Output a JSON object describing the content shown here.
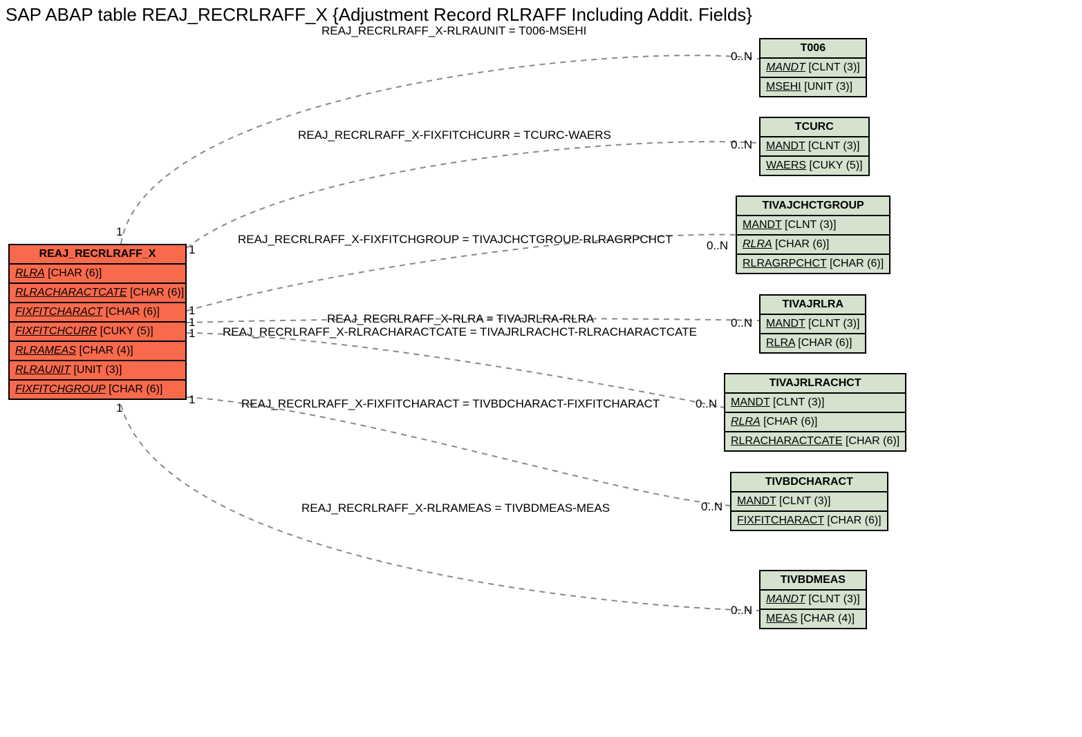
{
  "title": "SAP ABAP table REAJ_RECRLRAFF_X {Adjustment Record RLRAFF Including Addit. Fields}",
  "source": {
    "name": "REAJ_RECRLRAFF_X",
    "fields": [
      {
        "name": "RLRA",
        "type": "[CHAR (6)]",
        "italic": true
      },
      {
        "name": "RLRACHARACTCATE",
        "type": "[CHAR (6)]",
        "italic": true
      },
      {
        "name": "FIXFITCHARACT",
        "type": "[CHAR (6)]",
        "italic": true
      },
      {
        "name": "FIXFITCHCURR",
        "type": "[CUKY (5)]",
        "italic": true
      },
      {
        "name": "RLRAMEAS",
        "type": "[CHAR (4)]",
        "italic": true
      },
      {
        "name": "RLRAUNIT",
        "type": "[UNIT (3)]",
        "italic": true
      },
      {
        "name": "FIXFITCHGROUP",
        "type": "[CHAR (6)]",
        "italic": true
      }
    ]
  },
  "targets": [
    {
      "name": "T006",
      "fields": [
        {
          "name": "MANDT",
          "type": "[CLNT (3)]",
          "italic": true
        },
        {
          "name": "MSEHI",
          "type": "[UNIT (3)]",
          "italic": false
        }
      ]
    },
    {
      "name": "TCURC",
      "fields": [
        {
          "name": "MANDT",
          "type": "[CLNT (3)]",
          "italic": false
        },
        {
          "name": "WAERS",
          "type": "[CUKY (5)]",
          "italic": false
        }
      ]
    },
    {
      "name": "TIVAJCHCTGROUP",
      "fields": [
        {
          "name": "MANDT",
          "type": "[CLNT (3)]",
          "italic": false
        },
        {
          "name": "RLRA",
          "type": "[CHAR (6)]",
          "italic": true
        },
        {
          "name": "RLRAGRPCHCT",
          "type": "[CHAR (6)]",
          "italic": false
        }
      ]
    },
    {
      "name": "TIVAJRLRA",
      "fields": [
        {
          "name": "MANDT",
          "type": "[CLNT (3)]",
          "italic": false
        },
        {
          "name": "RLRA",
          "type": "[CHAR (6)]",
          "italic": false
        }
      ]
    },
    {
      "name": "TIVAJRLRACHCT",
      "fields": [
        {
          "name": "MANDT",
          "type": "[CLNT (3)]",
          "italic": false
        },
        {
          "name": "RLRA",
          "type": "[CHAR (6)]",
          "italic": true
        },
        {
          "name": "RLRACHARACTCATE",
          "type": "[CHAR (6)]",
          "italic": false
        }
      ]
    },
    {
      "name": "TIVBDCHARACT",
      "fields": [
        {
          "name": "MANDT",
          "type": "[CLNT (3)]",
          "italic": false
        },
        {
          "name": "FIXFITCHARACT",
          "type": "[CHAR (6)]",
          "italic": false
        }
      ]
    },
    {
      "name": "TIVBDMEAS",
      "fields": [
        {
          "name": "MANDT",
          "type": "[CLNT (3)]",
          "italic": true
        },
        {
          "name": "MEAS",
          "type": "[CHAR (4)]",
          "italic": false
        }
      ]
    }
  ],
  "relations": [
    {
      "label": "REAJ_RECRLRAFF_X-RLRAUNIT = T006-MSEHI",
      "left_card": "1",
      "right_card": "0..N"
    },
    {
      "label": "REAJ_RECRLRAFF_X-FIXFITCHCURR = TCURC-WAERS",
      "left_card": "1",
      "right_card": "0..N"
    },
    {
      "label": "REAJ_RECRLRAFF_X-FIXFITCHGROUP = TIVAJCHCTGROUP-RLRAGRPCHCT",
      "left_card": "1",
      "right_card": "0..N"
    },
    {
      "label": "REAJ_RECRLRAFF_X-RLRA = TIVAJRLRA-RLRA",
      "left_card": "1",
      "right_card": "0..N"
    },
    {
      "label": "REAJ_RECRLRAFF_X-RLRACHARACTCATE = TIVAJRLRACHCT-RLRACHARACTCATE",
      "left_card": "1",
      "right_card": "0..N"
    },
    {
      "label": "REAJ_RECRLRAFF_X-FIXFITCHARACT = TIVBDCHARACT-FIXFITCHARACT",
      "left_card": "1",
      "right_card": "0..N"
    },
    {
      "label": "REAJ_RECRLRAFF_X-RLRAMEAS = TIVBDMEAS-MEAS",
      "left_card": "1",
      "right_card": "0..N"
    }
  ]
}
